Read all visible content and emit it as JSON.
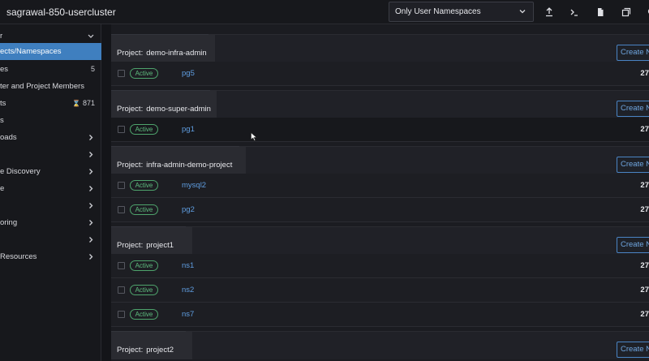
{
  "header": {
    "cluster_name": "sagrawal-850-usercluster",
    "namespace_filter": "Only User Namespaces"
  },
  "sidebar": {
    "items": [
      {
        "label": "r",
        "count": "",
        "arrow": "chevron-down",
        "active": false
      },
      {
        "label": "ects/Namespaces",
        "count": "",
        "arrow": "",
        "active": true
      },
      {
        "label": "es",
        "count": "5",
        "arrow": "",
        "active": false
      },
      {
        "label": "ter and Project Members",
        "count": "",
        "arrow": "",
        "active": false
      },
      {
        "label": "ts",
        "count": "871",
        "arrow": "",
        "active": false
      },
      {
        "label": "s",
        "count": "",
        "arrow": "",
        "active": false
      },
      {
        "label": "oads",
        "count": "",
        "arrow": "chevron-right",
        "active": false
      },
      {
        "label": "",
        "count": "",
        "arrow": "chevron-right",
        "active": false
      },
      {
        "label": "e Discovery",
        "count": "",
        "arrow": "chevron-right",
        "active": false
      },
      {
        "label": "e",
        "count": "",
        "arrow": "chevron-right",
        "active": false
      },
      {
        "label": "",
        "count": "",
        "arrow": "chevron-right",
        "active": false
      },
      {
        "label": "oring",
        "count": "",
        "arrow": "chevron-right",
        "active": false
      },
      {
        "label": "",
        "count": "",
        "arrow": "chevron-right",
        "active": false
      },
      {
        "label": "Resources",
        "count": "",
        "arrow": "chevron-right",
        "active": false
      }
    ]
  },
  "groups": [
    {
      "prefix": "Project:",
      "name": "demo-infra-admin",
      "button": "Create Namespace",
      "rows": [
        {
          "status": "Active",
          "name": "pg5",
          "age": "27"
        }
      ]
    },
    {
      "prefix": "Project:",
      "name": "demo-super-admin",
      "button": "Create Namespace",
      "rows": [
        {
          "status": "Active",
          "name": "pg1",
          "age": "27"
        }
      ]
    },
    {
      "prefix": "Project:",
      "name": "infra-admin-demo-project",
      "button": "Create Namespace",
      "rows": [
        {
          "status": "Active",
          "name": "mysql2",
          "age": "27"
        },
        {
          "status": "Active",
          "name": "pg2",
          "age": "27"
        }
      ]
    },
    {
      "prefix": "Project:",
      "name": "project1",
      "button": "Create Namespace",
      "rows": [
        {
          "status": "Active",
          "name": "ns1",
          "age": "27"
        },
        {
          "status": "Active",
          "name": "ns2",
          "age": "27"
        },
        {
          "status": "Active",
          "name": "ns7",
          "age": "27"
        }
      ]
    },
    {
      "prefix": "Project:",
      "name": "project2",
      "button": "Create Namespace",
      "rows": []
    }
  ]
}
